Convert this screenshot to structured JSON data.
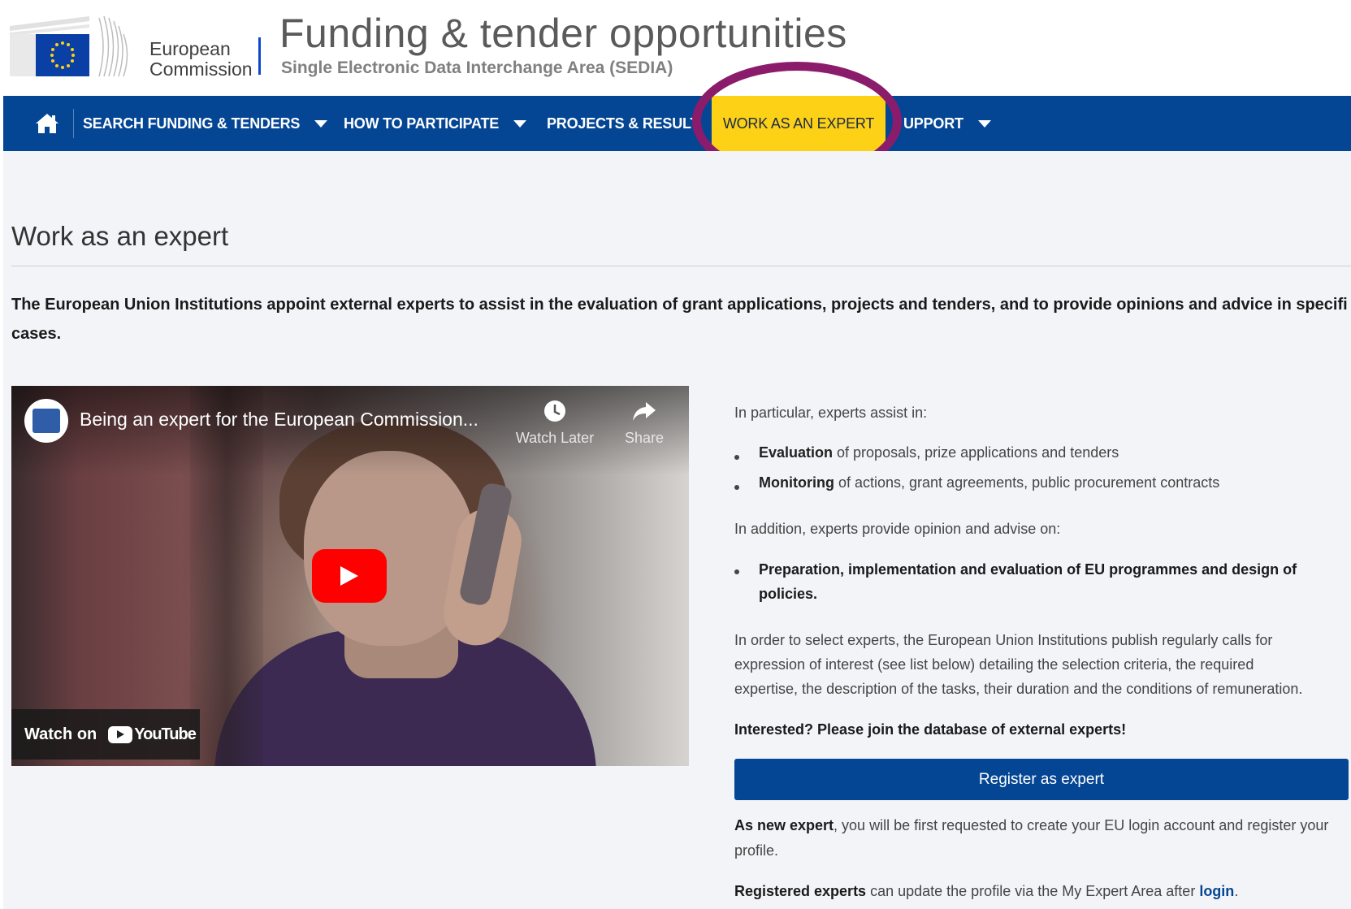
{
  "header": {
    "org_line1": "European",
    "org_line2": "Commission",
    "title": "Funding & tender opportunities",
    "subtitle": "Single Electronic Data Interchange Area (SEDIA)"
  },
  "nav": {
    "home_icon": "home-icon",
    "items": [
      {
        "label": "SEARCH FUNDING & TENDERS",
        "has_dropdown": true
      },
      {
        "label": "HOW TO PARTICIPATE",
        "has_dropdown": true
      },
      {
        "label": "PROJECTS & RESULT",
        "has_dropdown": false
      },
      {
        "label": "WORK AS AN EXPERT",
        "active": true
      },
      {
        "label": "UPPORT",
        "has_dropdown": true
      }
    ],
    "colors": {
      "bar": "#044694",
      "active": "#fcd116",
      "annotation_circle": "#8b1c6c"
    }
  },
  "page": {
    "title": "Work as an expert",
    "intro_line1": "The European Union Institutions appoint external experts to assist in the evaluation of grant applications, projects and tenders, and to provide opinions and advice in specifi",
    "intro_line2": "cases."
  },
  "video": {
    "title": "Being an expert for the European Commission...",
    "watch_later": "Watch Later",
    "share": "Share",
    "watch_on": "Watch on",
    "youtube": "YouTube"
  },
  "info": {
    "assist_intro": "In particular, experts assist in:",
    "assist_items": [
      {
        "bold": "Evaluation",
        "rest": " of proposals, prize applications and tenders"
      },
      {
        "bold": "Monitoring",
        "rest": " of actions, grant agreements, public procurement contracts"
      }
    ],
    "advise_intro": "In addition, experts provide opinion and advise on:",
    "advise_line1": "Preparation, implementation and evaluation of EU programmes and design of",
    "advise_line2": "policies.",
    "select_line1": "In order to select experts, the European Union Institutions publish regularly calls for",
    "select_line2": "expression of interest (see list below) detailing the selection criteria, the required",
    "select_line3": "expertise, the description of the tasks, their duration and the conditions of remuneration.",
    "cta": "Interested? Please join the database of external experts!",
    "register_button": "Register as expert",
    "new_expert_bold": "As new expert",
    "new_expert_rest": ", you will be first requested to create your EU login account and register your",
    "new_expert_line2": "profile.",
    "registered_bold": "Registered experts",
    "registered_rest": " can update the profile via the My Expert Area after ",
    "login_link": "login",
    "registered_end": "."
  }
}
